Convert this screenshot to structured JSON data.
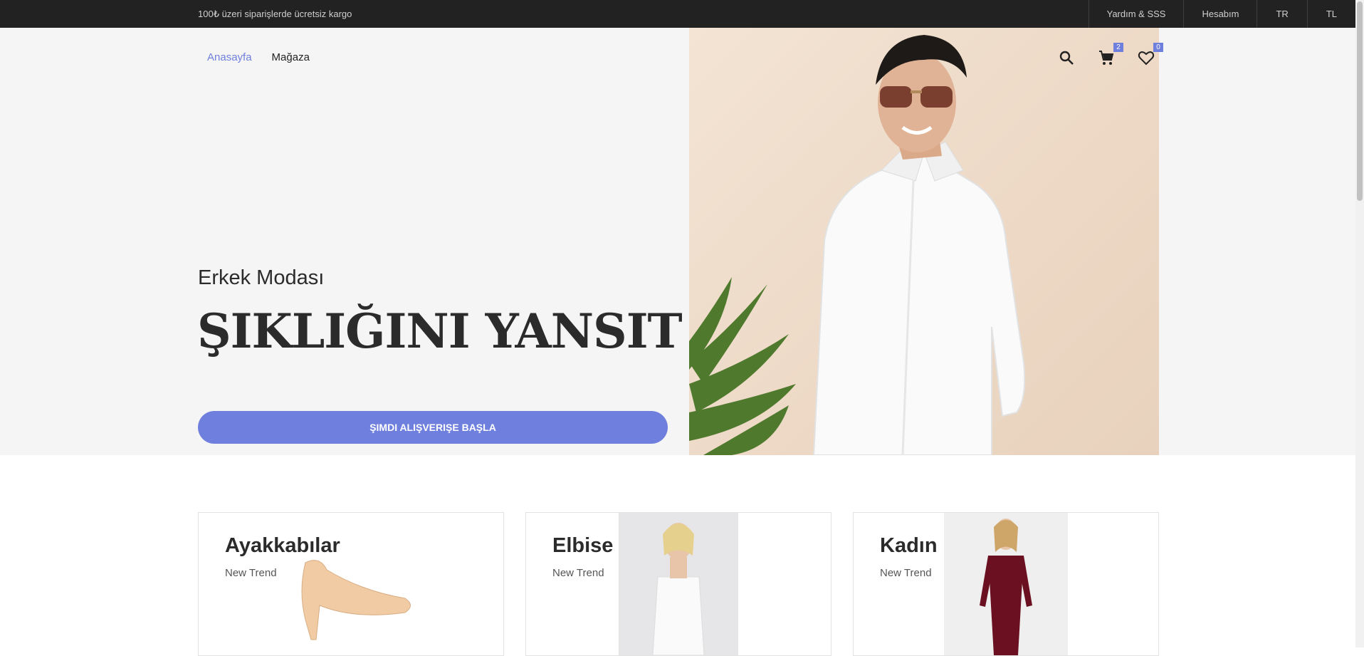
{
  "topbar": {
    "promo": "100₺ üzeri siparişlerde ücretsiz kargo",
    "links": [
      "Yardım & SSS",
      "Hesabım",
      "TR",
      "TL"
    ]
  },
  "nav": {
    "home": "Anasayfa",
    "shop": "Mağaza"
  },
  "header": {
    "cart_count": "2",
    "wishlist_count": "0"
  },
  "hero": {
    "subtitle": "Erkek Modası",
    "title": "ŞIKLIĞINI YANSIT",
    "cta": "ŞIMDI ALIŞVERIŞE BAŞLA"
  },
  "categories": [
    {
      "title": "Ayakkabılar",
      "tag": "New Trend"
    },
    {
      "title": "Elbise",
      "tag": "New Trend"
    },
    {
      "title": "Kadın",
      "tag": "New Trend"
    }
  ],
  "colors": {
    "accent": "#6f7fdd",
    "topbar": "#222222",
    "hero_bg": "#f5f5f5"
  }
}
